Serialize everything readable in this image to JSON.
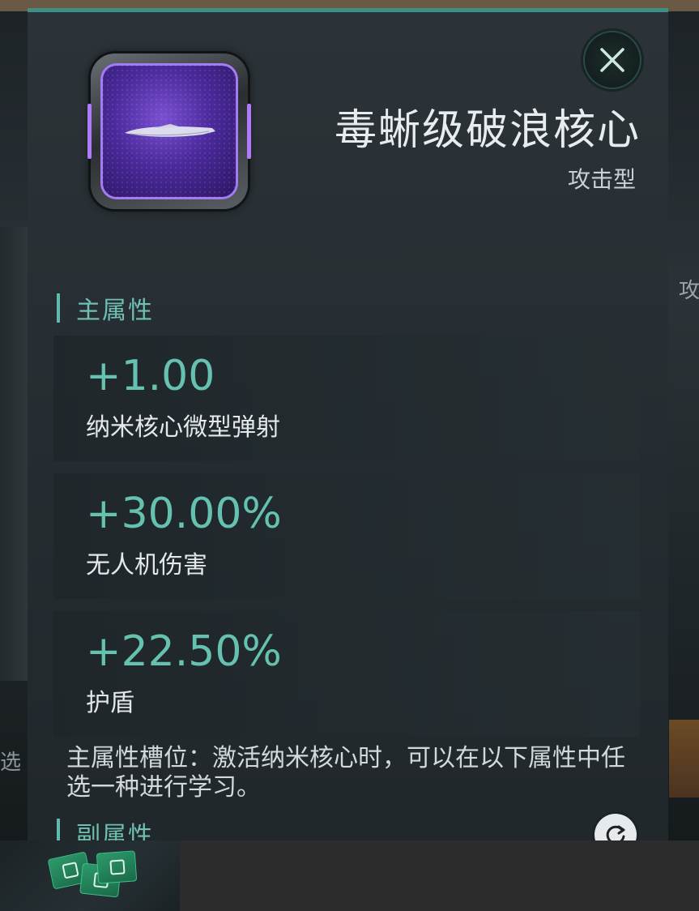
{
  "item": {
    "title": "毒蜥级破浪核心",
    "type": "攻击型",
    "icon": "ship-core-icon",
    "rarity_color": "#7a4fd1"
  },
  "main_attributes": {
    "label": "主属性",
    "stats": [
      {
        "value": "+1.00",
        "name": "纳米核心微型弹射"
      },
      {
        "value": "+30.00%",
        "name": "无人机伤害"
      },
      {
        "value": "+22.50%",
        "name": "护盾"
      }
    ]
  },
  "description": "主属性槽位：激活纳米核心时，可以在以下属性中任选一种进行学习。",
  "sub_attributes": {
    "label": "副属性"
  },
  "background": {
    "right_text": "攻",
    "left_text": "选"
  },
  "colors": {
    "accent": "#66c2b0",
    "panel": "#2c3439",
    "title": "#e8ecee"
  }
}
